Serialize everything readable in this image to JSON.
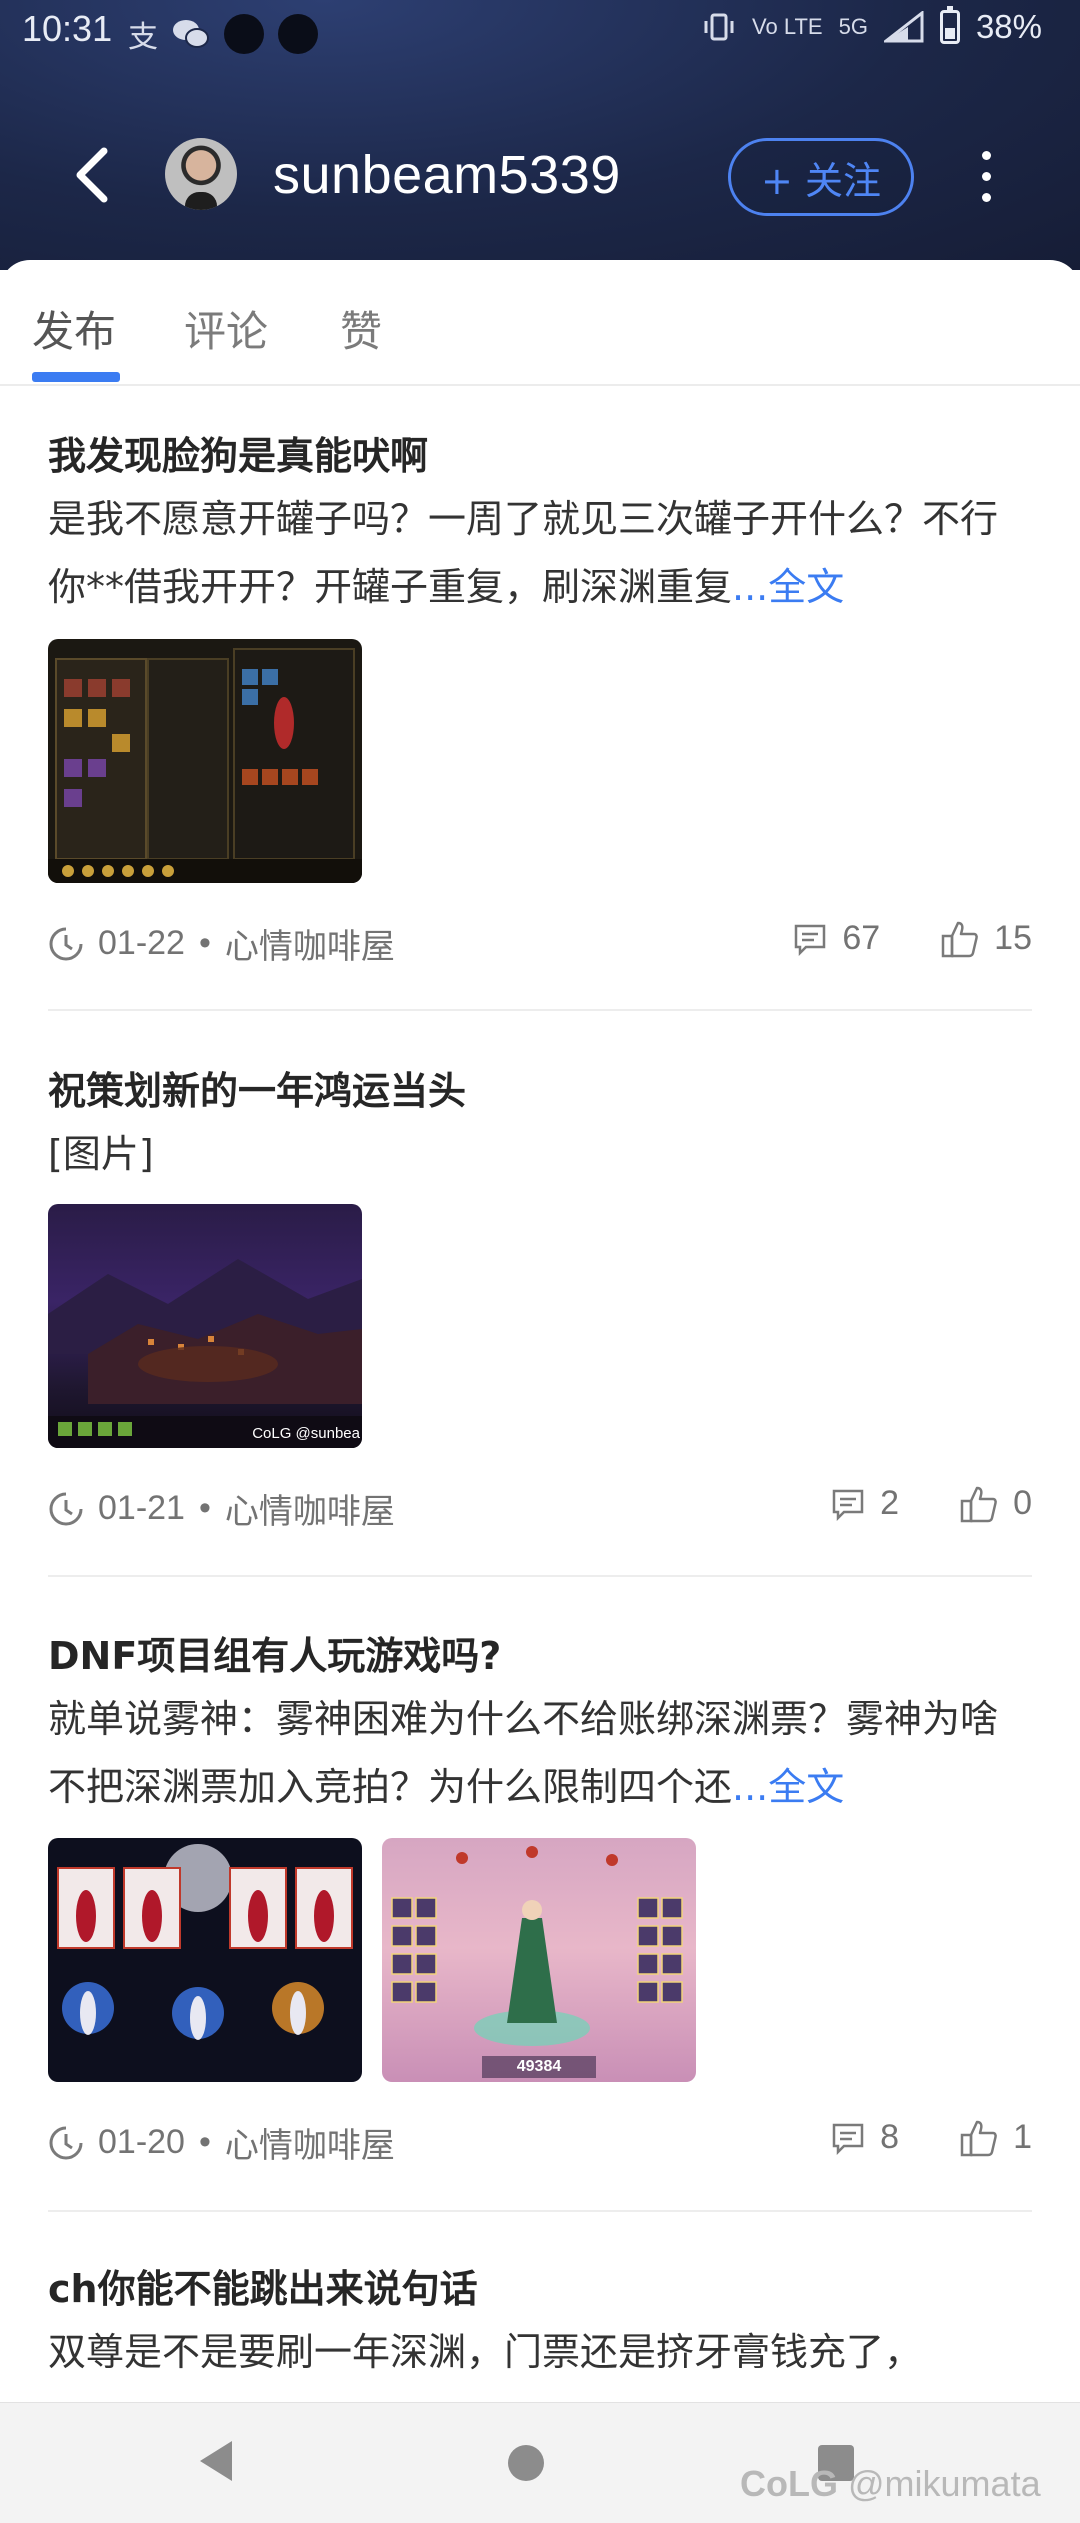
{
  "status_bar": {
    "time": "10:31",
    "left_icons": [
      "支",
      "wechat-icon",
      "dot",
      "dot"
    ],
    "volte": "Vo LTE",
    "network": "5G",
    "battery": "38%"
  },
  "header": {
    "username": "sunbeam5339",
    "follow_label": "+ 关注"
  },
  "tabs": [
    {
      "label": "发布",
      "active": true
    },
    {
      "label": "评论",
      "active": false
    },
    {
      "label": "赞",
      "active": false
    }
  ],
  "posts": [
    {
      "title": "我发现脸狗是真能吠啊",
      "body": "是我不愿意开罐子吗？一周了就见三次罐子开什么？不行你**借我开开？开罐子重复，刷深渊重复",
      "more": "...全文",
      "date": "01-22",
      "separator": "•",
      "board": "心情咖啡屋",
      "comments": "67",
      "likes": "15"
    },
    {
      "title": "祝策划新的一年鸿运当头",
      "body": "[图片]",
      "thumb_watermark": "CoLG @sunbea",
      "date": "01-21",
      "separator": "•",
      "board": "心情咖啡屋",
      "comments": "2",
      "likes": "0"
    },
    {
      "title": "DNF项目组有人玩游戏吗?",
      "body": "就单说雾神：雾神困难为什么不给账绑深渊票？雾神为啥不把深渊票加入竞拍？为什么限制四个还",
      "more": "...全文",
      "thumb_number": "49384",
      "date": "01-20",
      "separator": "•",
      "board": "心情咖啡屋",
      "comments": "8",
      "likes": "1"
    },
    {
      "title": "ch你能不能跳出来说句话",
      "body": "双尊是不是要刷一年深渊，门票还是挤牙膏钱充了，"
    }
  ],
  "watermark": {
    "brand": "CoLG",
    "handle": "@mikumata"
  },
  "colors": {
    "accent": "#3b7cf2",
    "header_bg": "#1c2748",
    "text_meta": "#737373"
  }
}
